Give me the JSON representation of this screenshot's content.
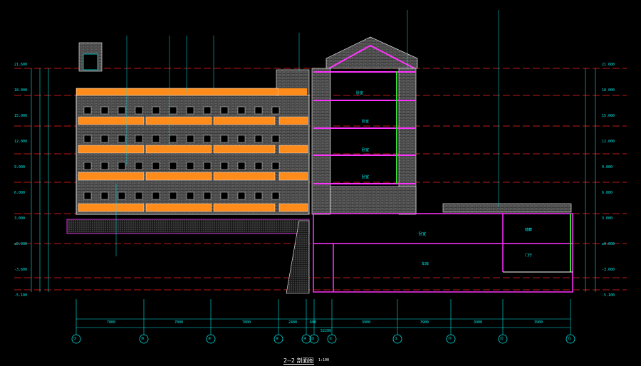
{
  "drawing": {
    "title": "2--2 剖面图",
    "scale": "1:100"
  },
  "colors": {
    "background": "#000000",
    "grid_line": "#ff2020",
    "dimension": "#00e6e6",
    "structure": "#ff33ff",
    "balcony": "#ff8c1a",
    "wall": "#ffffff",
    "hatch": "#bbbbbb",
    "ground": "#c8c8c8",
    "column": "#33dd33"
  },
  "axis_markers": [
    "①",
    "⑩",
    "⑨",
    "⑥",
    "④",
    "③",
    "②",
    "①",
    "⑪",
    "⑫",
    "⑬"
  ],
  "level_marks_left": [
    "21.600",
    "18.000",
    "15.000",
    "12.000",
    "9.000",
    "6.000",
    "3.000",
    "±0.000",
    "-3.600",
    "-5.100"
  ],
  "level_marks_right": [
    "21.600",
    "18.000",
    "15.000",
    "12.000",
    "9.000",
    "6.000",
    "3.000",
    "±0.000",
    "-3.600",
    "-5.100"
  ],
  "room_labels": [
    "卧室",
    "卧室",
    "卧室",
    "卧室",
    "卧室",
    "车库",
    "储藏",
    "门厅"
  ],
  "dimension_labels": [
    "7800",
    "7800",
    "7800",
    "2400",
    "600",
    "3900",
    "3900",
    "3900",
    "3900",
    "52200"
  ]
}
